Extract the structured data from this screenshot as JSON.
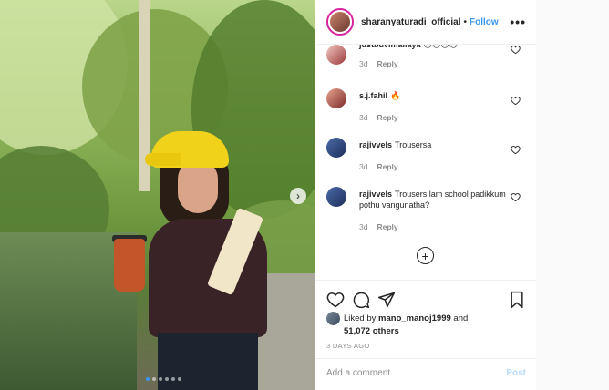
{
  "post": {
    "username": "sharanyaturadi_official",
    "separator": "•",
    "follow_label": "Follow",
    "more_icon": "more-options-icon"
  },
  "comments": [
    {
      "user": "justbuvimallaya",
      "text": "😊😊😊😊",
      "age": "3d",
      "reply": "Reply"
    },
    {
      "user": "s.j.fahil",
      "text": "🔥",
      "age": "3d",
      "reply": "Reply"
    },
    {
      "user": "rajivvels",
      "text": "Trousersa",
      "age": "3d",
      "reply": "Reply"
    },
    {
      "user": "rajivvels",
      "text": "Trousers lam school padikkum pothu vangunatha?",
      "age": "3d",
      "reply": "Reply"
    }
  ],
  "likes": {
    "prefix": "Liked by",
    "user": "mano_manoj1999",
    "conjunction": "and",
    "others": "51,072 others"
  },
  "time_ago": "3 DAYS AGO",
  "add_comment": {
    "placeholder": "Add a comment...",
    "post_label": "Post"
  },
  "carousel": {
    "next_glyph": "›",
    "dot_count": 6,
    "active_index": 0
  },
  "colors": {
    "accent": "#3897f0",
    "post_disabled": "#b3dbff",
    "muted": "#8e8e8e",
    "text": "#262626"
  }
}
